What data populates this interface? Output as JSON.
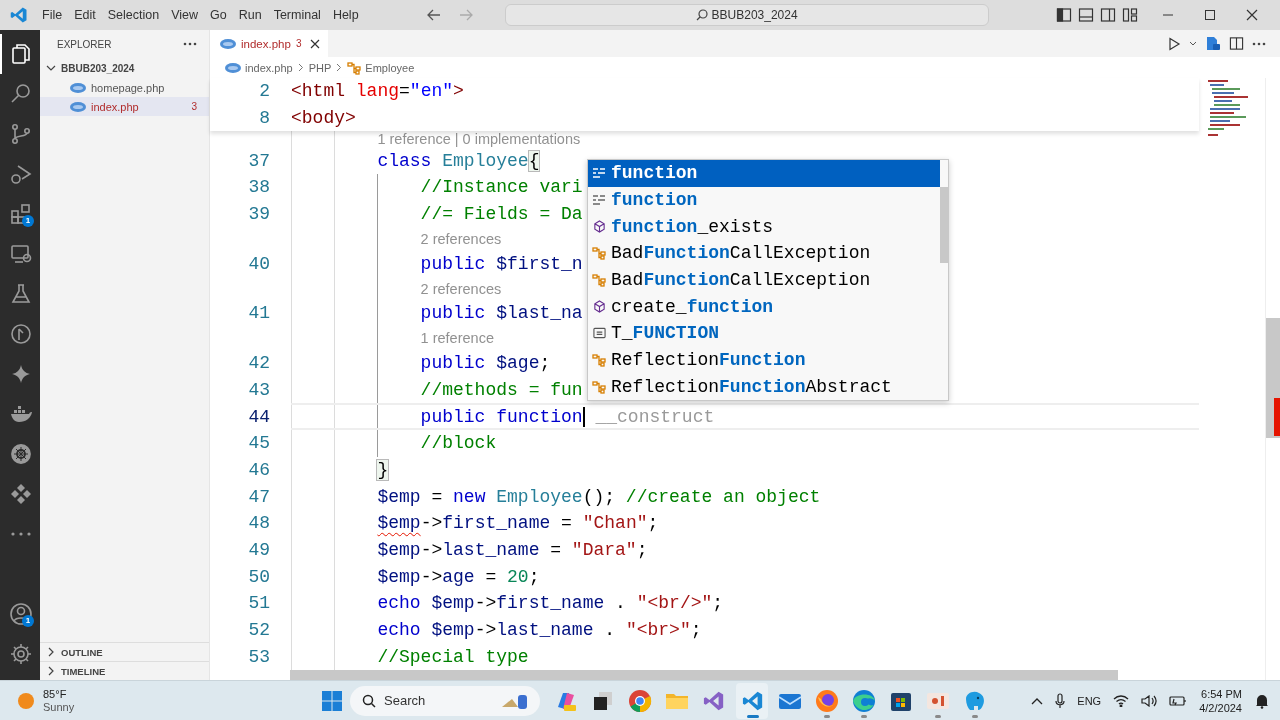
{
  "title_bar": {
    "menu": [
      "File",
      "Edit",
      "Selection",
      "View",
      "Go",
      "Run",
      "Terminal",
      "Help"
    ],
    "command_center": "BBUB203_2024"
  },
  "activity_bar": {
    "top": [
      {
        "kind": "files",
        "selected": true
      },
      {
        "kind": "search",
        "selected": false
      },
      {
        "kind": "source-control",
        "selected": false
      },
      {
        "kind": "run-debug",
        "selected": false
      },
      {
        "kind": "extensions",
        "selected": false,
        "badge": "1"
      },
      {
        "kind": "remote",
        "selected": false
      },
      {
        "kind": "testing",
        "selected": false
      },
      {
        "kind": "git-graph",
        "selected": false
      },
      {
        "kind": "sparkle",
        "selected": false
      },
      {
        "kind": "docker",
        "selected": false
      },
      {
        "kind": "kubernetes",
        "selected": false
      },
      {
        "kind": "diamonds",
        "selected": false
      },
      {
        "kind": "more",
        "selected": false
      }
    ],
    "bottom": [
      {
        "kind": "account",
        "selected": false,
        "badge": "1"
      },
      {
        "kind": "settings",
        "selected": false
      }
    ]
  },
  "sidebar": {
    "title": "EXPLORER",
    "folder": {
      "name": "BBUB203_2024",
      "expanded": true,
      "children": [
        {
          "name": "homepage.php",
          "selected": false,
          "has_errors": false
        },
        {
          "name": "index.php",
          "selected": true,
          "has_errors": true,
          "problems": "3"
        }
      ]
    },
    "sections": [
      {
        "label": "OUTLINE",
        "expanded": false
      },
      {
        "label": "TIMELINE",
        "expanded": false
      }
    ]
  },
  "editor": {
    "tabs": [
      {
        "label": "index.php",
        "problems": "3",
        "selected": true,
        "has_errors": true
      }
    ],
    "breadcrumb": [
      {
        "kind": "file",
        "label": "index.php"
      },
      {
        "kind": "plain",
        "label": "PHP"
      },
      {
        "kind": "class",
        "label": "Employee"
      }
    ],
    "sticky_lines": [
      {
        "number": "2",
        "tokens": [
          {
            "t": "<html",
            "kind": "tag"
          },
          {
            "t": " lang",
            "kind": "attr"
          },
          {
            "t": "=",
            "kind": "plain"
          },
          {
            "t": "\"en\"",
            "kind": "attrval"
          },
          {
            "t": ">",
            "kind": "tag"
          }
        ]
      },
      {
        "number": "8",
        "tokens": [
          {
            "t": "<body>",
            "kind": "tag"
          }
        ]
      }
    ],
    "lines": [
      {
        "kind": "codelens",
        "text": "1 reference | 0 implementations"
      },
      {
        "kind": "code",
        "number": "37",
        "tokens": [
          {
            "t": "        class",
            "kind": "keyword"
          },
          {
            "t": " Employee",
            "kind": "type"
          },
          {
            "t": "{",
            "kind": "plain",
            "bracket_match": true
          }
        ]
      },
      {
        "kind": "code",
        "number": "38",
        "tokens": [
          {
            "t": "            //Instance vari",
            "kind": "comment"
          }
        ]
      },
      {
        "kind": "code",
        "number": "39",
        "tokens": [
          {
            "t": "            //= Fields = Da",
            "kind": "comment"
          }
        ]
      },
      {
        "kind": "codelens",
        "text": "2 references"
      },
      {
        "kind": "code",
        "number": "40",
        "tokens": [
          {
            "t": "            public",
            "kind": "keyword"
          },
          {
            "t": " $first_n",
            "kind": "variable"
          }
        ]
      },
      {
        "kind": "codelens",
        "text": "2 references"
      },
      {
        "kind": "code",
        "number": "41",
        "tokens": [
          {
            "t": "            public",
            "kind": "keyword"
          },
          {
            "t": " $last_na",
            "kind": "variable"
          }
        ]
      },
      {
        "kind": "codelens",
        "text": "1 reference"
      },
      {
        "kind": "code",
        "number": "42",
        "tokens": [
          {
            "t": "            public",
            "kind": "keyword"
          },
          {
            "t": " $age",
            "kind": "variable"
          },
          {
            "t": ";",
            "kind": "plain"
          }
        ]
      },
      {
        "kind": "code",
        "number": "43",
        "tokens": [
          {
            "t": "            //methods = fun",
            "kind": "comment"
          }
        ]
      },
      {
        "kind": "code",
        "number": "44",
        "current": true,
        "cursor": true,
        "ghost": "__construct",
        "tokens": [
          {
            "t": "            public",
            "kind": "keyword"
          },
          {
            "t": " function",
            "kind": "keyword"
          }
        ]
      },
      {
        "kind": "code",
        "number": "45",
        "tokens": [
          {
            "t": "            //block",
            "kind": "comment"
          }
        ]
      },
      {
        "kind": "code",
        "number": "46",
        "tokens": [
          {
            "t": "        }",
            "kind": "plain",
            "bracket_match": true
          }
        ]
      },
      {
        "kind": "code",
        "number": "47",
        "tokens": [
          {
            "t": "        $emp",
            "kind": "variable"
          },
          {
            "t": " = ",
            "kind": "plain"
          },
          {
            "t": "new",
            "kind": "keyword"
          },
          {
            "t": " Employee",
            "kind": "type"
          },
          {
            "t": "();",
            "kind": "plain"
          },
          {
            "t": " //create an object",
            "kind": "comment"
          }
        ]
      },
      {
        "kind": "code",
        "number": "48",
        "tokens": [
          {
            "t": "        $emp",
            "kind": "variable",
            "error": true
          },
          {
            "t": "->",
            "kind": "plain"
          },
          {
            "t": "first_name",
            "kind": "variable"
          },
          {
            "t": " = ",
            "kind": "plain"
          },
          {
            "t": "\"Chan\"",
            "kind": "string"
          },
          {
            "t": ";",
            "kind": "plain"
          }
        ]
      },
      {
        "kind": "code",
        "number": "49",
        "tokens": [
          {
            "t": "        $emp",
            "kind": "variable"
          },
          {
            "t": "->",
            "kind": "plain"
          },
          {
            "t": "last_name",
            "kind": "variable"
          },
          {
            "t": " = ",
            "kind": "plain"
          },
          {
            "t": "\"Dara\"",
            "kind": "string"
          },
          {
            "t": ";",
            "kind": "plain"
          }
        ]
      },
      {
        "kind": "code",
        "number": "50",
        "tokens": [
          {
            "t": "        $emp",
            "kind": "variable"
          },
          {
            "t": "->",
            "kind": "plain"
          },
          {
            "t": "age",
            "kind": "variable"
          },
          {
            "t": " = ",
            "kind": "plain"
          },
          {
            "t": "20",
            "kind": "number"
          },
          {
            "t": ";",
            "kind": "plain"
          }
        ]
      },
      {
        "kind": "code",
        "number": "51",
        "tokens": [
          {
            "t": "        echo",
            "kind": "keyword"
          },
          {
            "t": " $emp",
            "kind": "variable"
          },
          {
            "t": "->",
            "kind": "plain"
          },
          {
            "t": "first_name",
            "kind": "variable"
          },
          {
            "t": " . ",
            "kind": "plain"
          },
          {
            "t": "\"<br/>\"",
            "kind": "string"
          },
          {
            "t": ";",
            "kind": "plain"
          }
        ]
      },
      {
        "kind": "code",
        "number": "52",
        "tokens": [
          {
            "t": "        echo",
            "kind": "keyword"
          },
          {
            "t": " $emp",
            "kind": "variable"
          },
          {
            "t": "->",
            "kind": "plain"
          },
          {
            "t": "last_name",
            "kind": "variable"
          },
          {
            "t": " . ",
            "kind": "plain"
          },
          {
            "t": "\"<br>\"",
            "kind": "string"
          },
          {
            "t": ";",
            "kind": "plain"
          }
        ]
      },
      {
        "kind": "code",
        "number": "53",
        "tokens": [
          {
            "t": "        //Special type",
            "kind": "comment"
          }
        ]
      }
    ],
    "suggestions": [
      {
        "kind": "keyword",
        "selected": true,
        "parts": [
          {
            "t": "function",
            "match": true
          }
        ]
      },
      {
        "kind": "keyword",
        "selected": false,
        "parts": [
          {
            "t": "function",
            "match": true
          }
        ]
      },
      {
        "kind": "method",
        "selected": false,
        "parts": [
          {
            "t": "function",
            "match": true
          },
          {
            "t": "_exists",
            "match": false
          }
        ]
      },
      {
        "kind": "class",
        "selected": false,
        "parts": [
          {
            "t": "Bad",
            "match": false
          },
          {
            "t": "Function",
            "match": true
          },
          {
            "t": "CallException",
            "match": false
          }
        ]
      },
      {
        "kind": "class",
        "selected": false,
        "parts": [
          {
            "t": "Bad",
            "match": false
          },
          {
            "t": "Function",
            "match": true
          },
          {
            "t": "CallException",
            "match": false
          }
        ]
      },
      {
        "kind": "method",
        "selected": false,
        "parts": [
          {
            "t": "create_",
            "match": false
          },
          {
            "t": "function",
            "match": true
          }
        ]
      },
      {
        "kind": "constant",
        "selected": false,
        "parts": [
          {
            "t": "T_",
            "match": false
          },
          {
            "t": "FUNCTION",
            "match": true
          }
        ]
      },
      {
        "kind": "class",
        "selected": false,
        "parts": [
          {
            "t": "Reflection",
            "match": false
          },
          {
            "t": "Function",
            "match": true
          }
        ]
      },
      {
        "kind": "class",
        "selected": false,
        "parts": [
          {
            "t": "Reflection",
            "match": false
          },
          {
            "t": "Function",
            "match": true
          },
          {
            "t": "Abstract",
            "match": false
          }
        ]
      }
    ]
  },
  "taskbar": {
    "weather": {
      "temp": "85°F",
      "condition": "Sunny"
    },
    "search": {
      "placeholder": "Search"
    },
    "apps": [
      {
        "kind": "copilot",
        "open": false,
        "active": false
      },
      {
        "kind": "task-view",
        "open": false,
        "active": false
      },
      {
        "kind": "chrome",
        "open": false,
        "active": false
      },
      {
        "kind": "folder",
        "open": false,
        "active": false
      },
      {
        "kind": "visual-studio",
        "open": false,
        "active": false
      },
      {
        "kind": "vscode",
        "open": true,
        "active": true
      },
      {
        "kind": "mail",
        "open": false,
        "active": false
      },
      {
        "kind": "firefox",
        "open": true,
        "active": false
      },
      {
        "kind": "edge",
        "open": true,
        "active": false
      },
      {
        "kind": "store",
        "open": false,
        "active": false
      },
      {
        "kind": "slides",
        "open": true,
        "active": false
      },
      {
        "kind": "elephant",
        "open": true,
        "active": false
      }
    ],
    "tray": {
      "language": "ENG",
      "time": "6:54 PM",
      "date": "4/2/2024"
    }
  }
}
